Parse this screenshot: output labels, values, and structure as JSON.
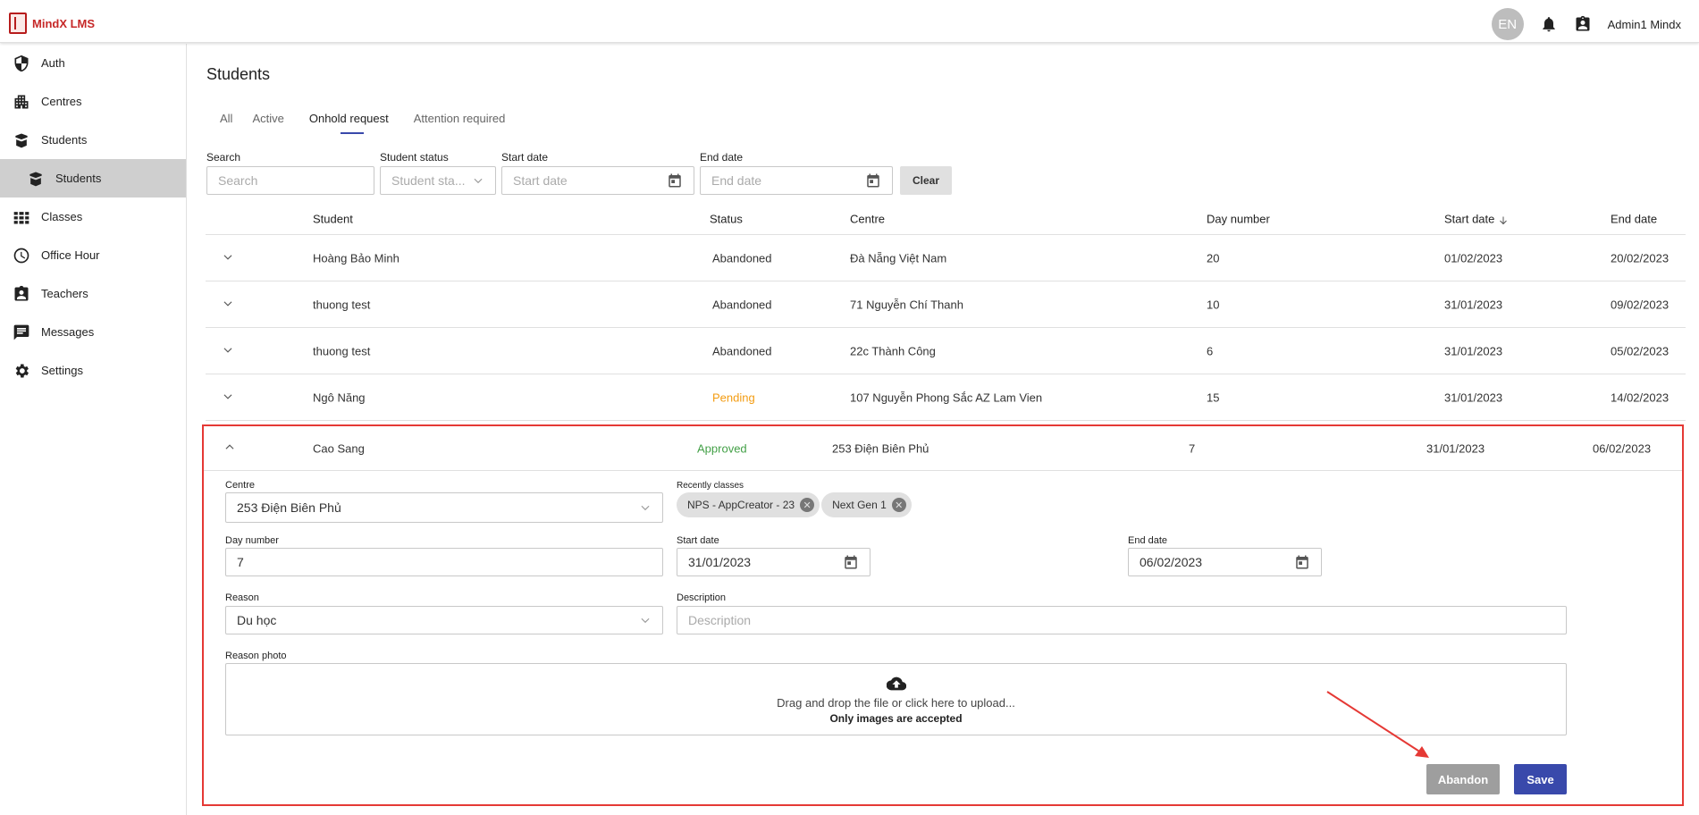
{
  "app": {
    "name": "MindX LMS"
  },
  "header": {
    "language": "EN",
    "user_name": "Admin1 Mindx"
  },
  "sidebar": {
    "items": [
      {
        "label": "Auth",
        "icon": "shield-icon"
      },
      {
        "label": "Centres",
        "icon": "building-icon"
      },
      {
        "label": "Students",
        "icon": "student-icon"
      },
      {
        "label": "Students",
        "icon": "student-icon",
        "sub": true,
        "selected": true
      },
      {
        "label": "Classes",
        "icon": "grid-icon"
      },
      {
        "label": "Office Hour",
        "icon": "clock-icon"
      },
      {
        "label": "Teachers",
        "icon": "badge-icon"
      },
      {
        "label": "Messages",
        "icon": "message-icon"
      },
      {
        "label": "Settings",
        "icon": "gear-icon"
      }
    ]
  },
  "page": {
    "title": "Students"
  },
  "tabs": [
    {
      "label": "All"
    },
    {
      "label": "Active"
    },
    {
      "label": "Onhold request",
      "active": true
    },
    {
      "label": "Attention required"
    }
  ],
  "filters": {
    "search": {
      "label": "Search",
      "placeholder": "Search"
    },
    "status": {
      "label": "Student status",
      "placeholder": "Student sta..."
    },
    "start": {
      "label": "Start date",
      "placeholder": "Start date"
    },
    "end": {
      "label": "End date",
      "placeholder": "End date"
    },
    "clear_label": "Clear"
  },
  "table": {
    "headers": {
      "student": "Student",
      "status": "Status",
      "centre": "Centre",
      "day": "Day number",
      "start": "Start date",
      "end": "End date"
    },
    "rows": [
      {
        "student": "Hoàng Bảo Minh",
        "status": "Abandoned",
        "centre": "Đà Nẵng Việt Nam",
        "day": "20",
        "start": "01/02/2023",
        "end": "20/02/2023"
      },
      {
        "student": "thuong test",
        "status": "Abandoned",
        "centre": "71 Nguyễn Chí Thanh",
        "day": "10",
        "start": "31/01/2023",
        "end": "09/02/2023"
      },
      {
        "student": "thuong test",
        "status": "Abandoned",
        "centre": "22c Thành Công",
        "day": "6",
        "start": "31/01/2023",
        "end": "05/02/2023"
      },
      {
        "student": "Ngô Năng",
        "status": "Pending",
        "centre": "107 Nguyễn Phong Sắc AZ Lam Vien",
        "day": "15",
        "start": "31/01/2023",
        "end": "14/02/2023"
      },
      {
        "student": "Cao Sang",
        "status": "Approved",
        "centre": "253 Điện Biên Phủ",
        "day": "7",
        "start": "31/01/2023",
        "end": "06/02/2023"
      }
    ]
  },
  "detail": {
    "centre_label": "Centre",
    "centre_value": "253 Điện Biên Phủ",
    "recent_classes_label": "Recently classes",
    "recent_classes": [
      "NPS - AppCreator - 23",
      "Next Gen 1"
    ],
    "day_label": "Day number",
    "day_value": "7",
    "start_label": "Start date",
    "start_value": "31/01/2023",
    "end_label": "End date",
    "end_value": "06/02/2023",
    "reason_label": "Reason",
    "reason_value": "Du học",
    "description_label": "Description",
    "description_placeholder": "Description",
    "photo_label": "Reason photo",
    "upload_text": "Drag and drop the file or click here to upload...",
    "upload_note": "Only images are accepted",
    "abandon_label": "Abandon",
    "save_label": "Save"
  },
  "colors": {
    "accent": "#3949ab",
    "pending": "#f39c12",
    "approved": "#43a047",
    "highlight": "#e53935"
  }
}
